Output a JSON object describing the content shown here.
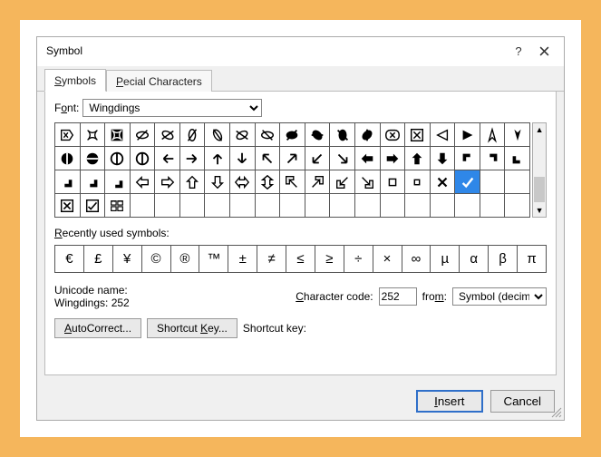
{
  "title": "Symbol",
  "tabs": {
    "symbols": "Symbols",
    "special": "Special Characters"
  },
  "font_label_pre": "F",
  "font_label_u": "o",
  "font_label_post": "nt:",
  "font_value": "Wingdings",
  "recent_label_pre": "",
  "recent_label_u": "R",
  "recent_label_post": "ecently used symbols:",
  "recent": [
    "€",
    "£",
    "¥",
    "©",
    "®",
    "™",
    "±",
    "≠",
    "≤",
    "≥",
    "÷",
    "×",
    "∞",
    "µ",
    "α",
    "β",
    "π"
  ],
  "unicode_name_label": "Unicode name:",
  "unicode_name_value": "Wingdings: 252",
  "charcode_label_u": "C",
  "charcode_label_post": "haracter code:",
  "charcode_value": "252",
  "from_label_pre": "fro",
  "from_label_u": "m",
  "from_label_post": ":",
  "from_value": "Symbol (decimal)",
  "autocorrect_label": "AutoCorrect...",
  "shortcutkey_btn_pre": "Shortcut ",
  "shortcutkey_btn_u": "K",
  "shortcutkey_btn_post": "ey...",
  "shortcutkey_label": "Shortcut key:",
  "insert_u": "I",
  "insert_post": "nsert",
  "cancel": "Cancel",
  "help": "?"
}
